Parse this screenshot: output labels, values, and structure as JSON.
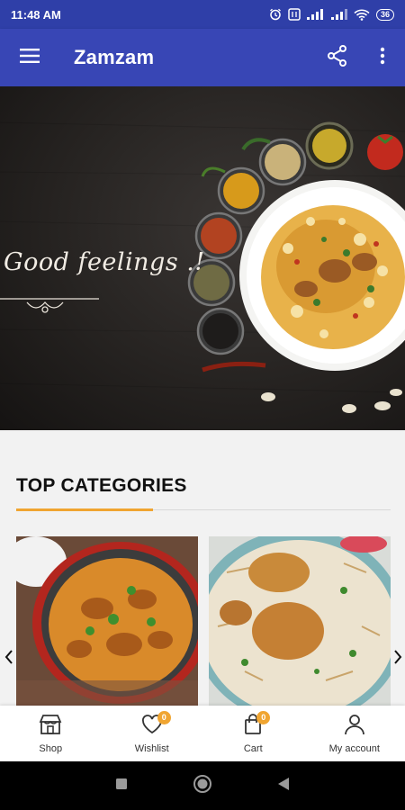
{
  "status_bar": {
    "time": "11:48 AM",
    "battery": "36",
    "icons": [
      "alarm-icon",
      "nfc-icon",
      "signal-icon",
      "signal-icon",
      "wifi-icon",
      "battery-icon"
    ]
  },
  "app_bar": {
    "title": "Zamzam",
    "icons": [
      "menu-icon",
      "share-icon",
      "more-vert-icon"
    ]
  },
  "banner": {
    "text": "Good feelings .!"
  },
  "categories": {
    "title": "TOP CATEGORIES",
    "accent_color": "#f0a531",
    "items": [
      {
        "image": "chicken-curry-image"
      },
      {
        "image": "chicken-biryani-image"
      }
    ]
  },
  "bottom_nav": {
    "items": [
      {
        "label": "Shop",
        "icon": "shop-icon"
      },
      {
        "label": "Wishlist",
        "icon": "heart-icon",
        "badge": "0"
      },
      {
        "label": "Cart",
        "icon": "bag-icon",
        "badge": "0"
      },
      {
        "label": "My account",
        "icon": "person-icon"
      }
    ]
  },
  "colors": {
    "status_bar": "#2f3fa8",
    "app_bar": "#3846b5"
  }
}
